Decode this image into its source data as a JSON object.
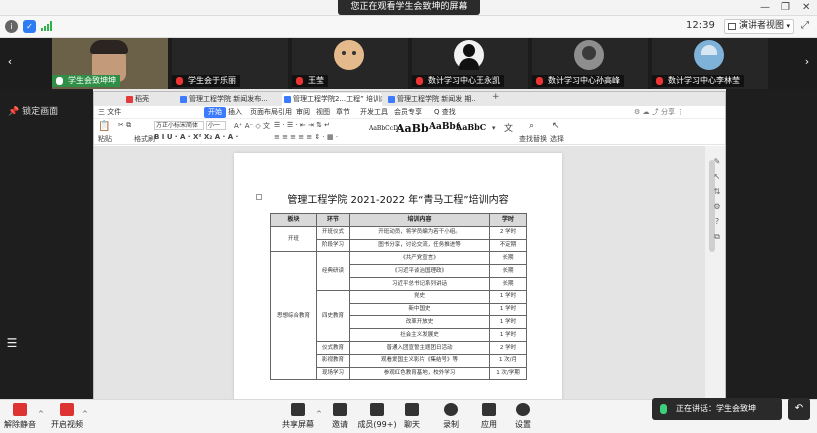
{
  "share_banner": "您正在观看学生会致坤的屏幕",
  "status": {
    "time": "12:39",
    "view_mode": "演讲者视图"
  },
  "participants": [
    {
      "name": "学生会致坤坤",
      "mic": "on"
    },
    {
      "name": "学生会于乐丽",
      "mic": "off"
    },
    {
      "name": "王莹",
      "mic": "off"
    },
    {
      "name": "数计学习中心王永凯",
      "mic": "off"
    },
    {
      "name": "数计学习中心孙高峰",
      "mic": "off"
    },
    {
      "name": "数计学习中心李林莹",
      "mic": "off"
    }
  ],
  "pin_label": "锁定画面",
  "wps": {
    "tabs": [
      {
        "label": "稻壳",
        "color": "#e23a3a"
      },
      {
        "label": "管理工程学院 新闻发布...",
        "color": "#3c7bff"
      },
      {
        "label": "管理工程学院2...工程” 培训内容",
        "color": "#3c7bff",
        "active": true
      },
      {
        "label": "管理工程学院 新闻发 期..",
        "color": "#3c7bff"
      }
    ],
    "menu": [
      "三 文件",
      "开始",
      "插入",
      "页面布局",
      "引用",
      "审阅",
      "视图",
      "章节",
      "开发工具",
      "会员专享",
      "Q 查找"
    ],
    "menu_selected": "开始",
    "ribbon": {
      "paste": "粘贴",
      "format_painter": "格式刷",
      "font_name": "方正小标宋简体",
      "font_size": "小一",
      "styles": [
        "AaBbCcDd",
        "AaBb",
        "AaBb(",
        "AaBbC"
      ],
      "find_replace": "查找替换",
      "select": "选择"
    }
  },
  "document": {
    "title": "管理工程学院 2021-2022 年“青马工程”培训内容",
    "headers": [
      "板块",
      "环节",
      "培训内容",
      "学时"
    ],
    "rows": [
      {
        "section": "开班",
        "stage": "开班仪式",
        "content": "开班动员，将学员编为若干小组。",
        "hours": "2 学时"
      },
      {
        "stage": "阶段学习",
        "content": "图书分享，讨论交流，任务推进等",
        "hours": "不定期"
      },
      {
        "stage": "经典研读",
        "content": "《共产党宣言》",
        "hours": "长期"
      },
      {
        "content": "《习近平谈治国理政》",
        "hours": "长期"
      },
      {
        "content": "习近平总书记系列讲话",
        "hours": "长期"
      },
      {
        "section": "思想综合教育",
        "stage": "四史教育",
        "content": "党史",
        "hours": "1 学时"
      },
      {
        "content": "新中国史",
        "hours": "1 学时"
      },
      {
        "content": "改革开放史",
        "hours": "1 学时"
      },
      {
        "content": "社会主义发展史",
        "hours": "1 学时"
      },
      {
        "stage": "仪式教育",
        "content": "普通入团宣誓主题团日活动",
        "hours": "2 学时"
      },
      {
        "stage": "影视教育",
        "content": "观看爱国主义影片《集结号》等",
        "hours": "1 次/月"
      },
      {
        "stage": "现场学习",
        "content": "参观红色教育基地，校外学习",
        "hours": "1 次/学期"
      }
    ]
  },
  "bottom": {
    "unmute": "解除静音",
    "start_video": "开启视频",
    "share_screen": "共享屏幕",
    "invite": "邀请",
    "members": "成员(99+)",
    "chat": "聊天",
    "record": "录制",
    "apps": "应用",
    "settings": "设置",
    "speaking_label": "正在讲话：学生会致坤"
  }
}
